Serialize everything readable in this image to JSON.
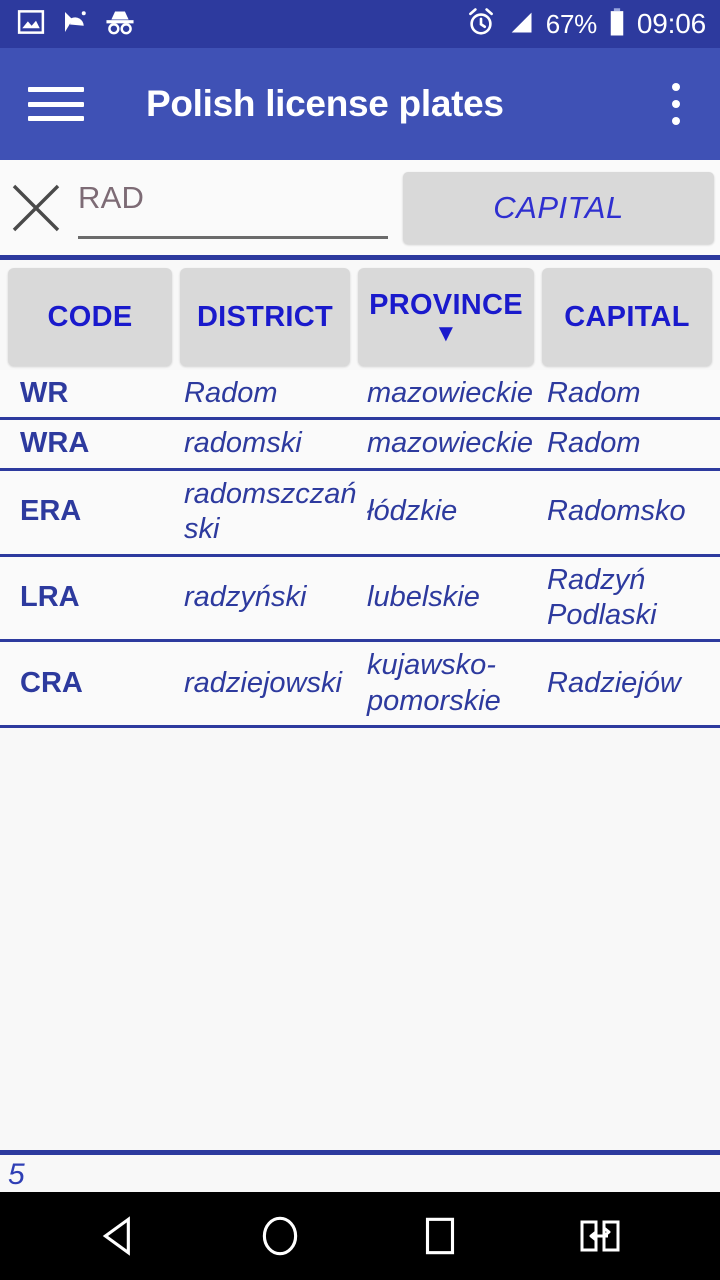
{
  "status_bar": {
    "icons_left": [
      "image-icon",
      "satellite-dish-icon",
      "incognito-glasses-icon"
    ],
    "alarm_icon": "alarm-clock-icon",
    "signal_icon": "signal-strength-icon",
    "battery_percent": "67%",
    "battery_icon": "battery-icon",
    "clock": "09:06",
    "background": "#2d3a9e"
  },
  "app_bar": {
    "menu_icon": "hamburger-menu-icon",
    "title": "Polish license plates",
    "overflow_icon": "overflow-menu-icon",
    "background": "#3f51b5"
  },
  "search": {
    "clear_icon": "close-x-icon",
    "query": "RAD",
    "placeholder": "RAD",
    "capital_button": "CAPITAL",
    "button_text_color": "#2f2fd0"
  },
  "columns": [
    {
      "key": "code",
      "label": "CODE",
      "sorted": false,
      "sort_arrow": ""
    },
    {
      "key": "district",
      "label": "DISTRICT",
      "sorted": false,
      "sort_arrow": ""
    },
    {
      "key": "province",
      "label": "PROVINCE",
      "sorted": true,
      "sort_arrow": "▼"
    },
    {
      "key": "capital",
      "label": "CAPITAL",
      "sorted": false,
      "sort_arrow": ""
    }
  ],
  "rows": [
    {
      "code": "WR",
      "district": "Radom",
      "province": "mazowieckie",
      "capital": "Radom"
    },
    {
      "code": "WRA",
      "district": "radomski",
      "province": "mazowieckie",
      "capital": "Radom"
    },
    {
      "code": "ERA",
      "district": "radomszczański",
      "province": "łódzkie",
      "capital": "Radomsko"
    },
    {
      "code": "LRA",
      "district": "radzyński",
      "province": "lubelskie",
      "capital": "Radzyń Podlaski"
    },
    {
      "code": "CRA",
      "district": "radziejowski",
      "province": "kujawsko-pomorskie",
      "capital": "Radziejów"
    }
  ],
  "footer": {
    "result_count": "5"
  },
  "nav_bar": {
    "back": "back-triangle-icon",
    "home": "home-circle-icon",
    "recents": "recents-square-icon",
    "rotate": "rotate-screen-icon",
    "background": "#000000"
  },
  "theme": {
    "primary": "#3f51b5",
    "primary_dark": "#2d3a9e",
    "accent_blue": "#1a1acc",
    "table_text": "#2d3a9e",
    "button_bg": "#d9d9d9",
    "page_bg": "#f8f8f8"
  }
}
